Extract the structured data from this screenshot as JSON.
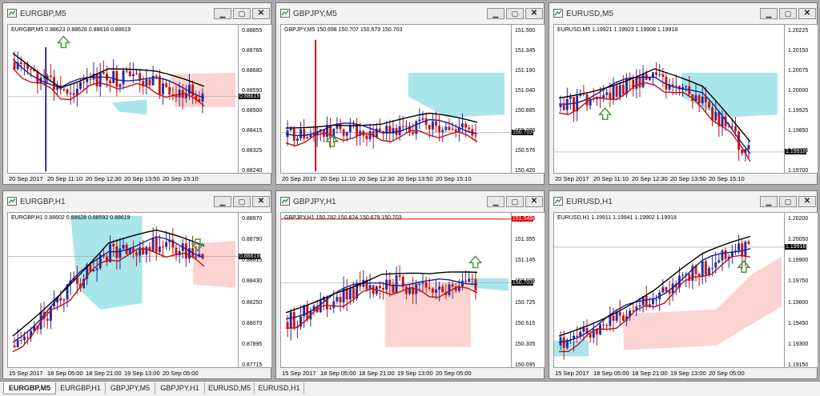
{
  "windows": [
    {
      "id": "w0",
      "title": "EURGBP,M5",
      "info": "EURGBP,M5  0.88623 0.88628 0.88618 0.88619",
      "ylabels": [
        "0.88855",
        "0.88765",
        "0.88680",
        "0.88590",
        "0.88500",
        "0.88415",
        "0.88325",
        "0.88240"
      ],
      "current": "0.88619",
      "xlabels": [
        "20 Sep 2017",
        "20 Sep 11:10",
        "20 Sep 12:30",
        "20 Sep 13:50",
        "20 Sep 15:10"
      ]
    },
    {
      "id": "w1",
      "title": "GBPJPY,M5",
      "info": "GBPJPY,M5  150.698 150.707 150.679 150.703",
      "ylabels": [
        "151.500",
        "151.345",
        "151.190",
        "151.040",
        "150.885",
        "150.730",
        "150.575",
        "150.420"
      ],
      "current": "150.703",
      "xlabels": [
        "20 Sep 2017",
        "20 Sep 11:10",
        "20 Sep 12:30",
        "20 Sep 13:50",
        "20 Sep 15:10"
      ]
    },
    {
      "id": "w2",
      "title": "EURUSD,M5",
      "info": "EURUSD,M5  1.19921 1.19923 1.19908 1.19918",
      "ylabels": [
        "1.20225",
        "1.20150",
        "1.20075",
        "1.20000",
        "1.19925",
        "1.19850",
        "1.19775",
        "1.19700"
      ],
      "current": "1.19918",
      "xlabels": [
        "20 Sep 2017",
        "20 Sep 11:10",
        "20 Sep 12:30",
        "20 Sep 13:50",
        "20 Sep 15:10"
      ]
    },
    {
      "id": "w3",
      "title": "EURGBP,H1",
      "info": "EURGBP,H1  0.88602 0.88628 0.88592 0.88619",
      "ylabels": [
        "0.88970",
        "0.88790",
        "0.88615",
        "0.88430",
        "0.88250",
        "0.88070",
        "0.87895",
        "0.87715"
      ],
      "current": "0.88619",
      "xlabels": [
        "15 Sep 2017",
        "18 Sep 05:00",
        "18 Sep 21:00",
        "19 Sep 13:00",
        "20 Sep 05:00"
      ]
    },
    {
      "id": "w4",
      "title": "GBPJPY,H1",
      "info": "GBPJPY,H1  150.782 150.824 150.679 150.703",
      "ylabels": [
        "151.565",
        "151.355",
        "151.145",
        "150.935",
        "150.725",
        "150.515",
        "150.305",
        "150.095"
      ],
      "current": "150.703",
      "alert": "151.549",
      "xlabels": [
        "15 Sep 2017",
        "18 Sep 05:00",
        "18 Sep 21:00",
        "19 Sep 13:00",
        "20 Sep 05:00"
      ]
    },
    {
      "id": "w5",
      "title": "EURUSD,H1",
      "info": "EURUSD,H1  1.19911 1.19941 1.19902 1.19918",
      "ylabels": [
        "1.20200",
        "1.20050",
        "1.19900",
        "1.19750",
        "1.19600",
        "1.19450",
        "1.19300",
        "1.19150"
      ],
      "current": "1.19918",
      "xlabels": [
        "15 Sep 2017",
        "18 Sep 05:00",
        "18 Sep 21:00",
        "19 Sep 13:00",
        "20 Sep 05:00"
      ]
    }
  ],
  "window_buttons": {
    "minimize": "▁",
    "maximize": "▢",
    "close": "✕"
  },
  "tabs": [
    "EURGBP,M5",
    "EURGBP,H1",
    "GBPJPY,M5",
    "GBPJPY,H1",
    "EURUSD,M5",
    "EURUSD,H1"
  ],
  "active_tab": "EURGBP,M5",
  "colors": {
    "bull": "#2a2a9c",
    "bear": "#cc1111",
    "ma_fast": "#c01010",
    "ma_mid": "#1c1c9c",
    "ma_slow": "#000000",
    "cloud_bull": "#a8e6ea",
    "cloud_bear": "#fbd3d0",
    "arrow": "#3a9a2a"
  }
}
